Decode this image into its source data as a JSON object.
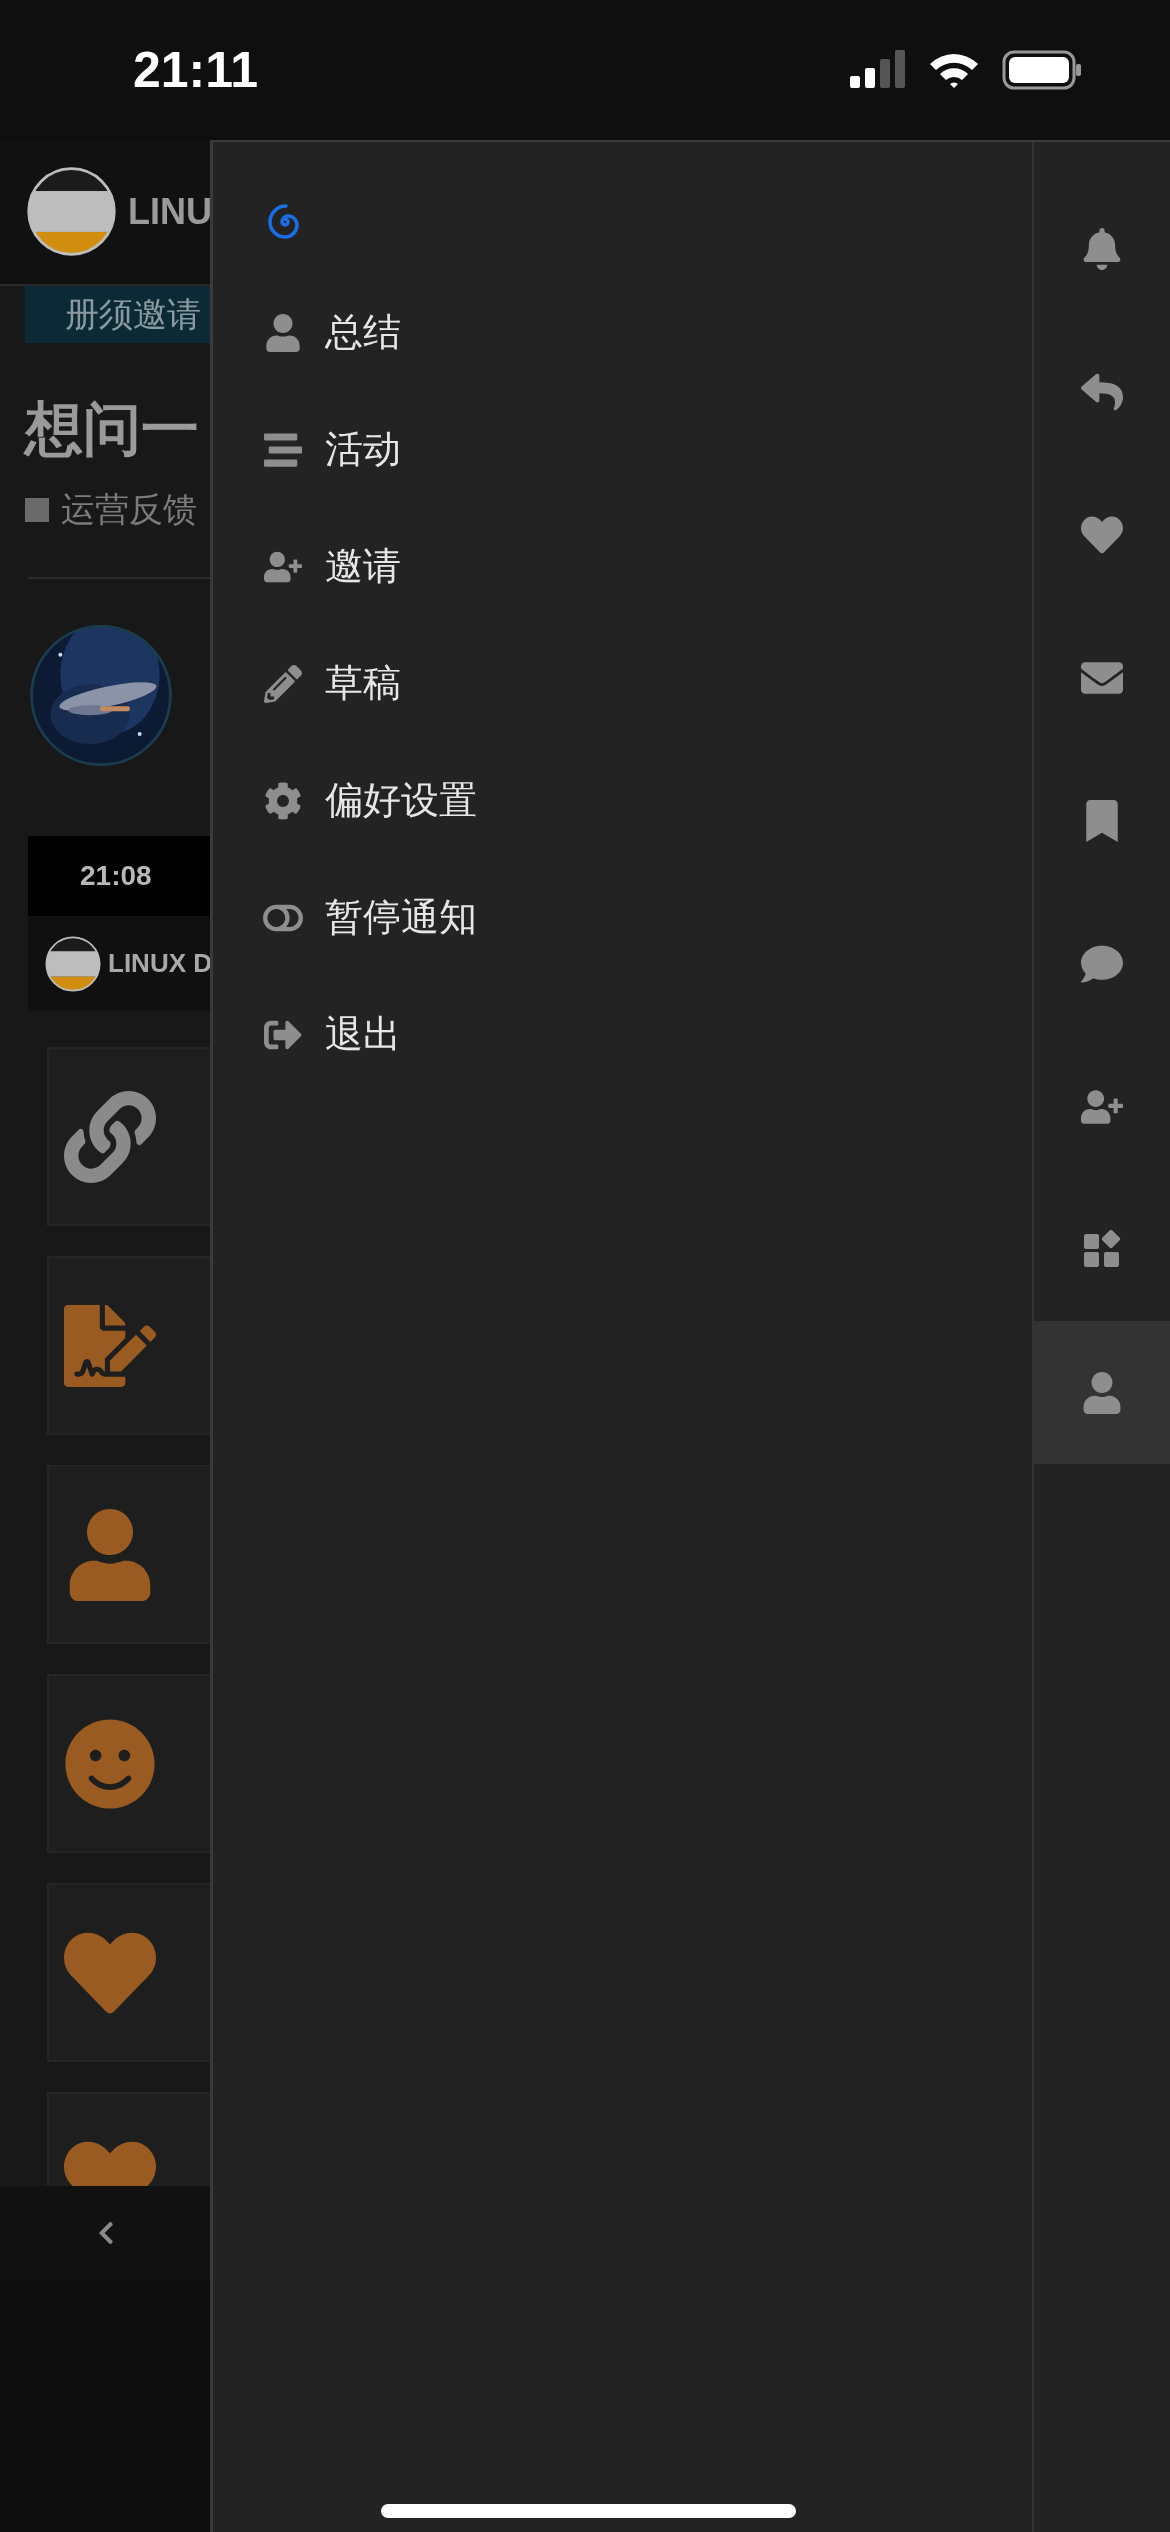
{
  "status_bar": {
    "time": "21:11"
  },
  "background_page": {
    "header": {
      "logo_text": "LINU"
    },
    "banner": "册须邀请",
    "title": "想问一",
    "category": "运营反馈",
    "embedded_screenshot": {
      "time": "21:08",
      "logo_text": "LINUX D"
    },
    "cards": [
      {
        "kind": "link"
      },
      {
        "kind": "signature"
      },
      {
        "kind": "user"
      },
      {
        "kind": "smile"
      },
      {
        "kind": "heart"
      },
      {
        "kind": "heart"
      }
    ]
  },
  "user_menu": {
    "items": [
      {
        "kind": "summary",
        "label": "总结"
      },
      {
        "kind": "activity",
        "label": "活动"
      },
      {
        "kind": "invite",
        "label": "邀请"
      },
      {
        "kind": "drafts",
        "label": "草稿"
      },
      {
        "kind": "preferences",
        "label": "偏好设置"
      },
      {
        "kind": "pause",
        "label": "暂停通知"
      },
      {
        "kind": "logout",
        "label": "退出"
      }
    ]
  },
  "quick_tabs": [
    {
      "kind": "notifications",
      "selected": false
    },
    {
      "kind": "replies",
      "selected": false
    },
    {
      "kind": "likes",
      "selected": false
    },
    {
      "kind": "messages",
      "selected": false
    },
    {
      "kind": "bookmarks",
      "selected": false
    },
    {
      "kind": "chat",
      "selected": false
    },
    {
      "kind": "invites",
      "selected": false
    },
    {
      "kind": "other",
      "selected": false
    },
    {
      "kind": "profile",
      "selected": true
    }
  ]
}
